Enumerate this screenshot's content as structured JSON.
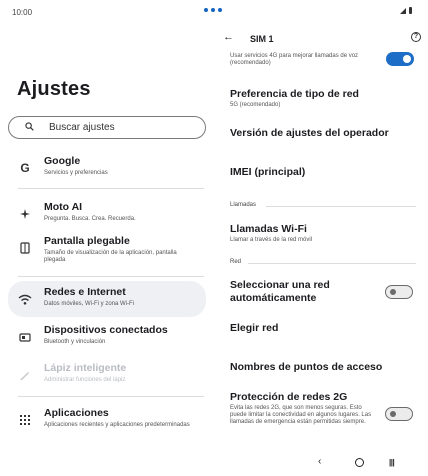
{
  "status_bar": {
    "time": "10:00"
  },
  "left_pane": {
    "title": "Ajustes",
    "search_placeholder": "Buscar ajustes",
    "items": [
      {
        "title": "Google",
        "subtitle": "Servicios y preferencias",
        "icon": "google-icon"
      },
      {
        "title": "Moto AI",
        "subtitle": "Pregunta. Busca. Crea. Recuerda.",
        "icon": "moto-ai-icon"
      },
      {
        "title": "Pantalla plegable",
        "subtitle": "Tamaño de visualización de la aplicación, pantalla plegada",
        "icon": "foldable-icon"
      },
      {
        "title": "Redes e Internet",
        "subtitle": "Datos móviles, Wi-Fi y zona Wi-Fi",
        "icon": "wifi-icon",
        "selected": true
      },
      {
        "title": "Dispositivos conectados",
        "subtitle": "Bluetooth y vinculación",
        "icon": "connected-devices-icon"
      },
      {
        "title": "Lápiz inteligente",
        "subtitle": "Administrar funciones del lápiz",
        "icon": "pen-icon",
        "disabled": true
      },
      {
        "title": "Aplicaciones",
        "subtitle": "Aplicaciones recientes y aplicaciones predeterminadas",
        "icon": "apps-icon"
      }
    ]
  },
  "right_pane": {
    "title": "SIM 1",
    "top_partial_text": "Usar servicios 4G para mejorar llamadas de voz (recomendado)",
    "top_toggle_on": true,
    "preferred_network": {
      "title": "Preferencia de tipo de red",
      "subtitle": "5G (recomendado)"
    },
    "carrier_settings_version": "Versión de ajustes del operador",
    "imei": "IMEI (principal)",
    "section_calls": "Llamadas",
    "wifi_calling": {
      "title": "Llamadas Wi-Fi",
      "subtitle": "Llamar a través de la red móvil"
    },
    "section_network": "Red",
    "auto_select": {
      "title": "Seleccionar una red automáticamente",
      "toggle_on": false
    },
    "choose_network": "Elegir red",
    "apn": "Nombres de puntos de acceso",
    "protection_2g": {
      "title": "Protección de redes 2G",
      "subtitle": "Evita las redes 2G, que son menos seguras. Esto puede limitar la conectividad en algunos lugares. Las llamadas de emergencia están permitidas siempre.",
      "toggle_on": false
    }
  },
  "colors": {
    "accent": "#1e6ec8",
    "selected_bg": "#eef0f4"
  }
}
